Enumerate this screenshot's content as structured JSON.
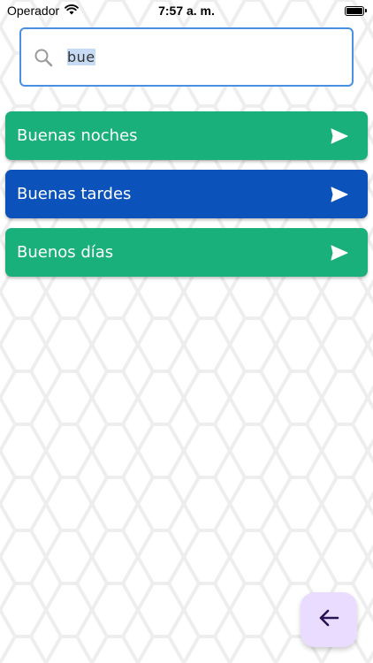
{
  "status_bar": {
    "carrier": "Operador",
    "time": "7:57 a. m.",
    "battery_level": 1.0
  },
  "search": {
    "value": "bue",
    "highlighted_text": "bue",
    "icon": "search-icon"
  },
  "results": {
    "items": [
      {
        "label": "Buenas noches",
        "color": "#19b07b",
        "icon": "send-icon"
      },
      {
        "label": "Buenas tardes",
        "color": "#0b53bb",
        "icon": "send-icon"
      },
      {
        "label": "Buenos días",
        "color": "#19b07b",
        "icon": "send-icon"
      }
    ]
  },
  "fab": {
    "icon": "arrow-left-icon",
    "color": "#eadcff",
    "icon_color": "#2a1355"
  },
  "theme": {
    "pattern_stroke": "#eeeeee",
    "search_border": "#4a90e2"
  }
}
